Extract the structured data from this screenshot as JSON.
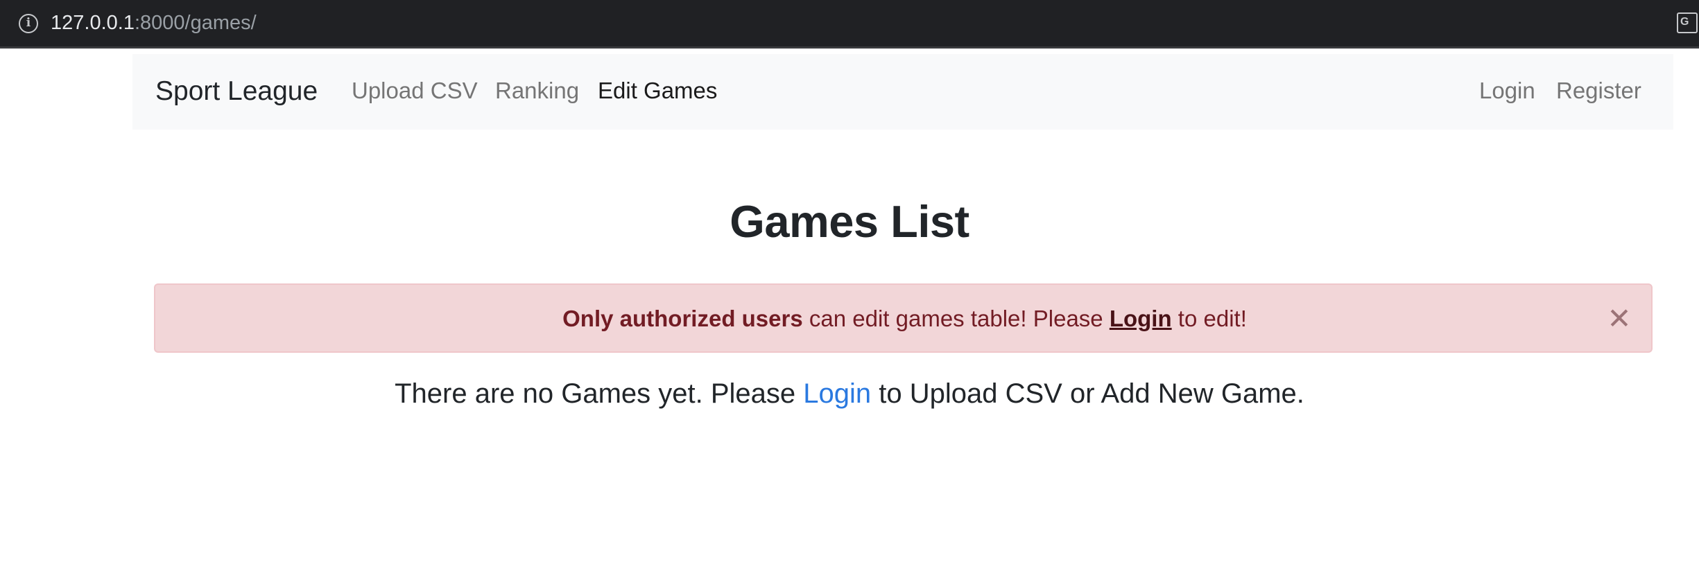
{
  "browser": {
    "url_host": "127.0.0.1",
    "url_path": ":8000/games/",
    "info_icon": "info-icon",
    "translate_icon": "translate-icon"
  },
  "navbar": {
    "brand": "Sport League",
    "links": [
      {
        "label": "Upload CSV",
        "active": false
      },
      {
        "label": "Ranking",
        "active": false
      },
      {
        "label": "Edit Games",
        "active": true
      }
    ],
    "auth_links": [
      {
        "label": "Login"
      },
      {
        "label": "Register"
      }
    ]
  },
  "main": {
    "title": "Games List",
    "alert": {
      "strong_text": "Only authorized users",
      "text_middle": " can edit games table! Please ",
      "link_text": "Login",
      "text_end": " to edit!",
      "close_symbol": "✕"
    },
    "empty_message": {
      "before": "There are no Games yet. Please ",
      "link_text": "Login",
      "after": " to Upload CSV or Add New Game."
    }
  },
  "colors": {
    "navbar_bg": "#f8f9fa",
    "alert_bg": "#f2d6d8",
    "alert_text": "#721c24",
    "link": "#2a79e0"
  }
}
